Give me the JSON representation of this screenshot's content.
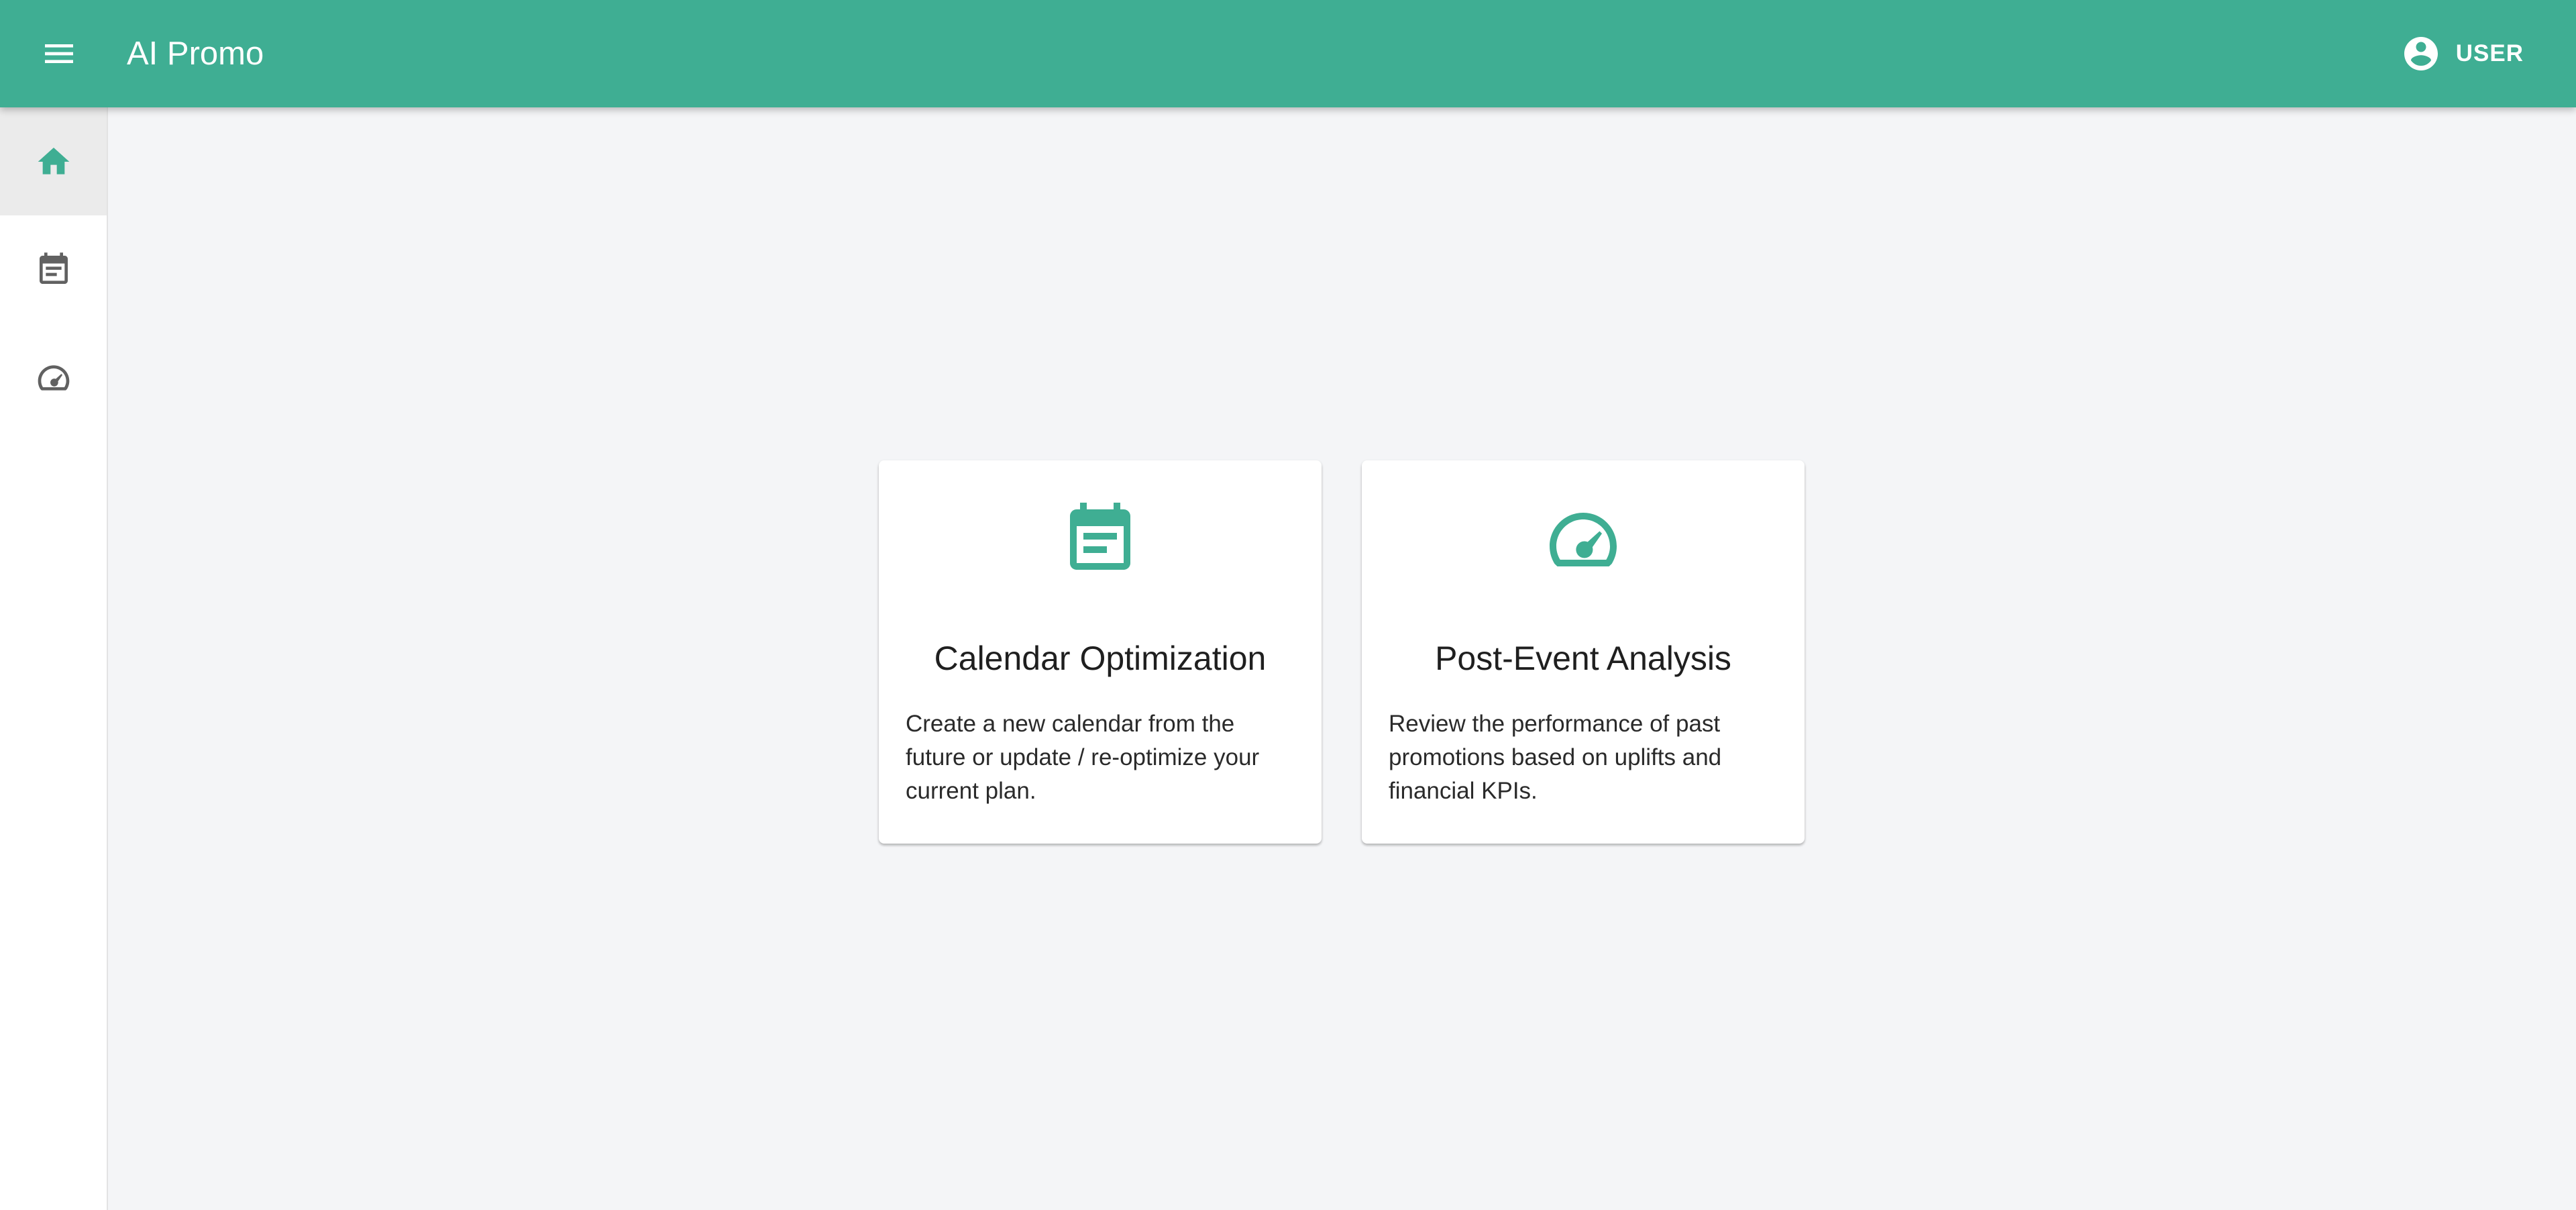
{
  "header": {
    "app_title": "AI Promo",
    "user_label": "USER",
    "menu_icon": "menu-icon",
    "user_icon": "account-circle-icon",
    "color": "#3fae93"
  },
  "sidebar": {
    "items": [
      {
        "icon": "home-icon",
        "active": true
      },
      {
        "icon": "calendar-icon",
        "active": false
      },
      {
        "icon": "speedometer-icon",
        "active": false
      }
    ],
    "active_color": "#3fae93",
    "inactive_color": "#616161"
  },
  "cards": [
    {
      "icon": "calendar-icon",
      "title": "Calendar Optimization",
      "description": "Create a new calendar from the future or update / re-optimize your current plan."
    },
    {
      "icon": "speedometer-icon",
      "title": "Post-Event Analysis",
      "description": "Review the performance of past promotions based on uplifts and financial KPIs."
    }
  ]
}
